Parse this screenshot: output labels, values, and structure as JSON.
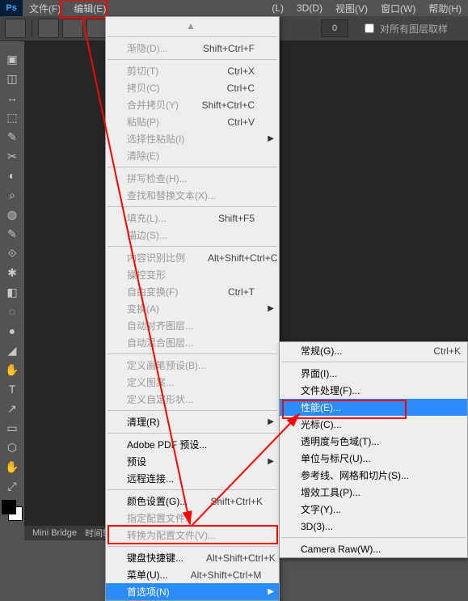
{
  "menubar": {
    "items": [
      "文件(F)",
      "编辑(E)",
      "",
      "(L)",
      "3D(D)",
      "视图(V)",
      "窗口(W)",
      "帮助(H)"
    ]
  },
  "toolbar": {
    "num": "0",
    "cb_label": "对所有图层取样"
  },
  "bottombar": {
    "tabs": [
      "Mini Bridge",
      "时间轴"
    ]
  },
  "edit_menu": [
    {
      "t": "triangle"
    },
    {
      "t": "sep"
    },
    {
      "t": "i",
      "label": "渐隐(D)...",
      "sc": "Shift+Ctrl+F",
      "dis": true
    },
    {
      "t": "sep"
    },
    {
      "t": "i",
      "label": "剪切(T)",
      "sc": "Ctrl+X",
      "dis": true
    },
    {
      "t": "i",
      "label": "拷贝(C)",
      "sc": "Ctrl+C",
      "dis": true
    },
    {
      "t": "i",
      "label": "合并拷贝(Y)",
      "sc": "Shift+Ctrl+C",
      "dis": true
    },
    {
      "t": "i",
      "label": "粘贴(P)",
      "sc": "Ctrl+V",
      "dis": true
    },
    {
      "t": "i",
      "label": "选择性粘贴(I)",
      "arrow": true,
      "dis": true
    },
    {
      "t": "i",
      "label": "清除(E)",
      "dis": true
    },
    {
      "t": "sep"
    },
    {
      "t": "i",
      "label": "拼写检查(H)...",
      "dis": true
    },
    {
      "t": "i",
      "label": "查找和替换文本(X)...",
      "dis": true
    },
    {
      "t": "sep"
    },
    {
      "t": "i",
      "label": "填充(L)...",
      "sc": "Shift+F5",
      "dis": true
    },
    {
      "t": "i",
      "label": "描边(S)...",
      "dis": true
    },
    {
      "t": "sep"
    },
    {
      "t": "i",
      "label": "内容识别比例",
      "sc": "Alt+Shift+Ctrl+C",
      "dis": true
    },
    {
      "t": "i",
      "label": "操控变形",
      "dis": true
    },
    {
      "t": "i",
      "label": "自由变换(F)",
      "sc": "Ctrl+T",
      "dis": true
    },
    {
      "t": "i",
      "label": "变换(A)",
      "arrow": true,
      "dis": true
    },
    {
      "t": "i",
      "label": "自动对齐图层...",
      "dis": true
    },
    {
      "t": "i",
      "label": "自动混合图层...",
      "dis": true
    },
    {
      "t": "sep"
    },
    {
      "t": "i",
      "label": "定义画笔预设(B)...",
      "dis": true
    },
    {
      "t": "i",
      "label": "定义图案...",
      "dis": true
    },
    {
      "t": "i",
      "label": "定义自定形状...",
      "dis": true
    },
    {
      "t": "sep"
    },
    {
      "t": "i",
      "label": "清理(R)",
      "arrow": true
    },
    {
      "t": "sep"
    },
    {
      "t": "i",
      "label": "Adobe PDF 预设..."
    },
    {
      "t": "i",
      "label": "预设",
      "arrow": true
    },
    {
      "t": "i",
      "label": "远程连接..."
    },
    {
      "t": "sep"
    },
    {
      "t": "i",
      "label": "颜色设置(G)...",
      "sc": "Shift+Ctrl+K"
    },
    {
      "t": "i",
      "label": "指定配置文件...",
      "dis": true
    },
    {
      "t": "i",
      "label": "转换为配置文件(V)...",
      "dis": true
    },
    {
      "t": "sep"
    },
    {
      "t": "i",
      "label": "键盘快捷键...",
      "sc": "Alt+Shift+Ctrl+K"
    },
    {
      "t": "i",
      "label": "菜单(U)...",
      "sc": "Alt+Shift+Ctrl+M"
    },
    {
      "t": "i",
      "label": "首选项(N)",
      "arrow": true,
      "hl": true,
      "blue": true
    }
  ],
  "sub_menu": [
    {
      "label": "常规(G)...",
      "sc": "Ctrl+K"
    },
    {
      "t": "sep"
    },
    {
      "label": "界面(I)..."
    },
    {
      "label": "文件处理(F)..."
    },
    {
      "label": "性能(E)...",
      "blue": true
    },
    {
      "label": "光标(C)..."
    },
    {
      "label": "透明度与色域(T)..."
    },
    {
      "label": "单位与标尺(U)..."
    },
    {
      "label": "参考线、网格和切片(S)..."
    },
    {
      "label": "增效工具(P)..."
    },
    {
      "label": "文字(Y)..."
    },
    {
      "label": "3D(3)..."
    },
    {
      "t": "sep"
    },
    {
      "label": "Camera Raw(W)..."
    }
  ],
  "tools": [
    "▣",
    "◫",
    "↔",
    "⬚",
    "✎",
    "✂",
    "◐",
    "⌕",
    "◍",
    "✎",
    "⟐",
    "✱",
    "◧",
    "◌",
    "●",
    "◢",
    "✋",
    "T",
    "↗",
    "▭",
    "⬡",
    "✋",
    "⤢"
  ]
}
